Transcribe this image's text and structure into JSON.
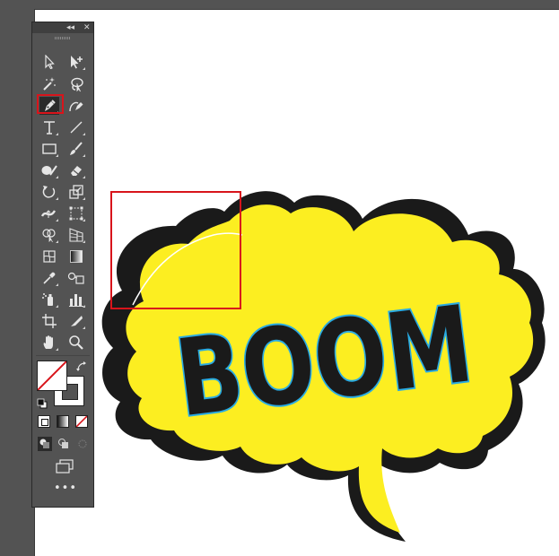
{
  "window": {
    "collapse_glyph": "◂◂",
    "close_glyph": "✕"
  },
  "toolbar": {
    "tools": [
      {
        "id": "selection",
        "icon": "selection-arrow-icon"
      },
      {
        "id": "direct-selection",
        "icon": "direct-selection-icon"
      },
      {
        "id": "magic-wand",
        "icon": "magic-wand-icon"
      },
      {
        "id": "lasso",
        "icon": "lasso-icon"
      },
      {
        "id": "pen",
        "icon": "pen-icon",
        "selected": true
      },
      {
        "id": "curvature",
        "icon": "curvature-icon"
      },
      {
        "id": "type",
        "icon": "type-icon",
        "glyph": "T"
      },
      {
        "id": "line-segment",
        "icon": "line-segment-icon"
      },
      {
        "id": "rectangle",
        "icon": "rectangle-icon"
      },
      {
        "id": "paintbrush",
        "icon": "paintbrush-icon"
      },
      {
        "id": "shaper",
        "icon": "shaper-icon"
      },
      {
        "id": "eraser",
        "icon": "eraser-icon"
      },
      {
        "id": "rotate",
        "icon": "rotate-icon"
      },
      {
        "id": "scale",
        "icon": "scale-icon"
      },
      {
        "id": "width",
        "icon": "width-icon"
      },
      {
        "id": "free-transform",
        "icon": "free-transform-icon"
      },
      {
        "id": "shape-builder",
        "icon": "shape-builder-icon"
      },
      {
        "id": "perspective-grid",
        "icon": "perspective-grid-icon"
      },
      {
        "id": "mesh",
        "icon": "mesh-icon"
      },
      {
        "id": "gradient",
        "icon": "gradient-icon"
      },
      {
        "id": "eyedropper",
        "icon": "eyedropper-icon"
      },
      {
        "id": "blend",
        "icon": "blend-icon"
      },
      {
        "id": "symbol-sprayer",
        "icon": "symbol-sprayer-icon"
      },
      {
        "id": "column-graph",
        "icon": "column-graph-icon"
      },
      {
        "id": "artboard",
        "icon": "artboard-icon"
      },
      {
        "id": "slice",
        "icon": "slice-icon"
      },
      {
        "id": "hand",
        "icon": "hand-icon"
      },
      {
        "id": "zoom",
        "icon": "zoom-icon"
      }
    ],
    "fill_color": "#ffffff",
    "stroke_color": "#535353",
    "more_glyph": "•••"
  },
  "canvas": {
    "artwork_text": "BOOM",
    "bubble_fill": "#fcee21",
    "bubble_shadow": "#1a1a1a",
    "letter_fill": "#1a1a1a",
    "letter_outline": "#29abe2",
    "highlight_stroke": "#ffffff",
    "selection_color": "#d8141b"
  }
}
